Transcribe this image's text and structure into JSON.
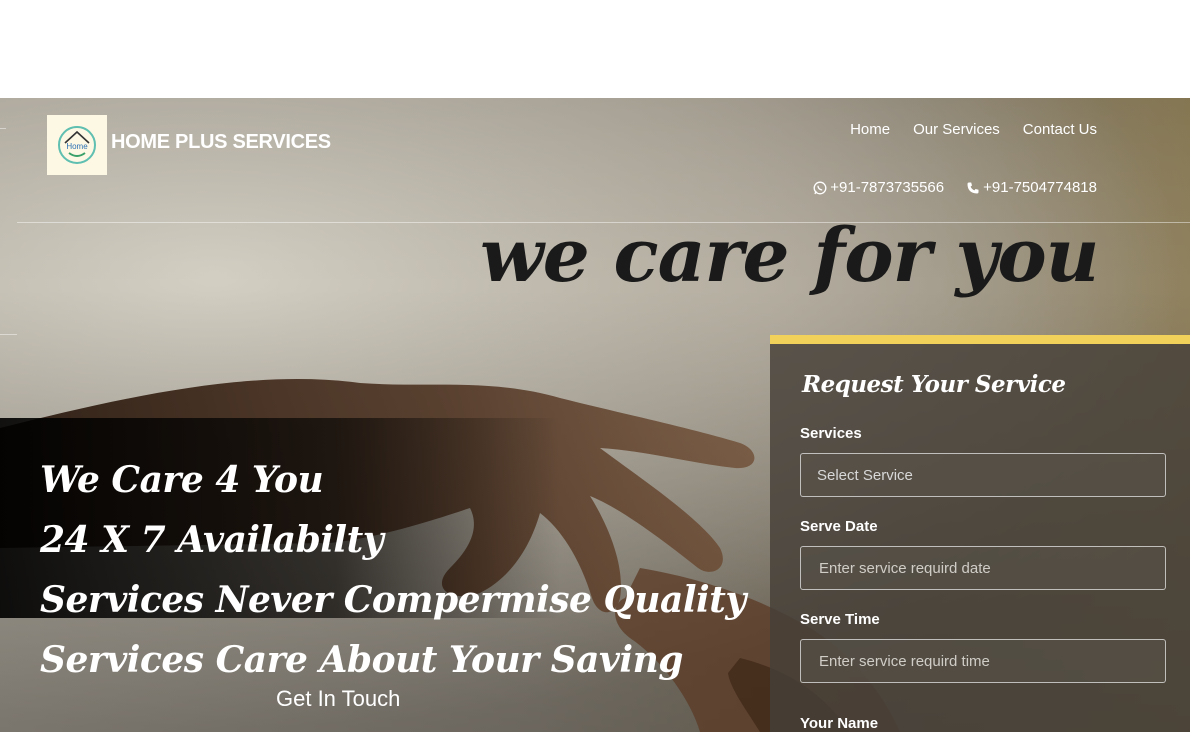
{
  "header": {
    "brand": "HOME PLUS SERVICES",
    "logo_text": "Home",
    "nav": [
      {
        "label": "Home"
      },
      {
        "label": "Our Services"
      },
      {
        "label": "Contact Us"
      }
    ],
    "phones": [
      {
        "icon": "whatsapp-icon",
        "number": "+91-7873735566"
      },
      {
        "icon": "phone-icon",
        "number": "+91-7504774818"
      }
    ]
  },
  "hero": {
    "script_title": "we care for you",
    "taglines": [
      "We Care 4 You",
      "24 X 7 Availabilty",
      "Services Never Compermise Quality",
      "Services Care About Your Saving"
    ],
    "cta": "Get In Touch"
  },
  "form": {
    "title": "Request Your Service",
    "fields": [
      {
        "label": "Services",
        "placeholder": "Select Service"
      },
      {
        "label": "Serve Date",
        "placeholder": "Enter service requird date"
      },
      {
        "label": "Serve Time",
        "placeholder": "Enter service requird time"
      },
      {
        "label": "Your Name"
      }
    ]
  },
  "colors": {
    "accent_yellow": "#f1d15a",
    "form_bg": "#463f37",
    "text_white": "#ffffff"
  }
}
